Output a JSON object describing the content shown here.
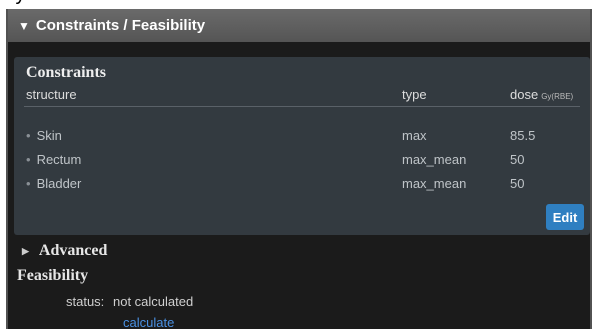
{
  "panel": {
    "title": "Constraints / Feasibility",
    "constraints": {
      "title": "Constraints",
      "columns": {
        "structure": "structure",
        "type": "type",
        "dose": "dose",
        "dose_unit": "Gy(RBE)"
      },
      "rows": [
        {
          "structure": "Skin",
          "type": "max",
          "dose": "85.5"
        },
        {
          "structure": "Rectum",
          "type": "max_mean",
          "dose": "50"
        },
        {
          "structure": "Bladder",
          "type": "max_mean",
          "dose": "50"
        }
      ],
      "edit_label": "Edit"
    },
    "advanced_label": "Advanced",
    "feasibility": {
      "title": "Feasibility",
      "status_label": "status:",
      "status_value": "not calculated",
      "calculate_label": "calculate"
    }
  }
}
